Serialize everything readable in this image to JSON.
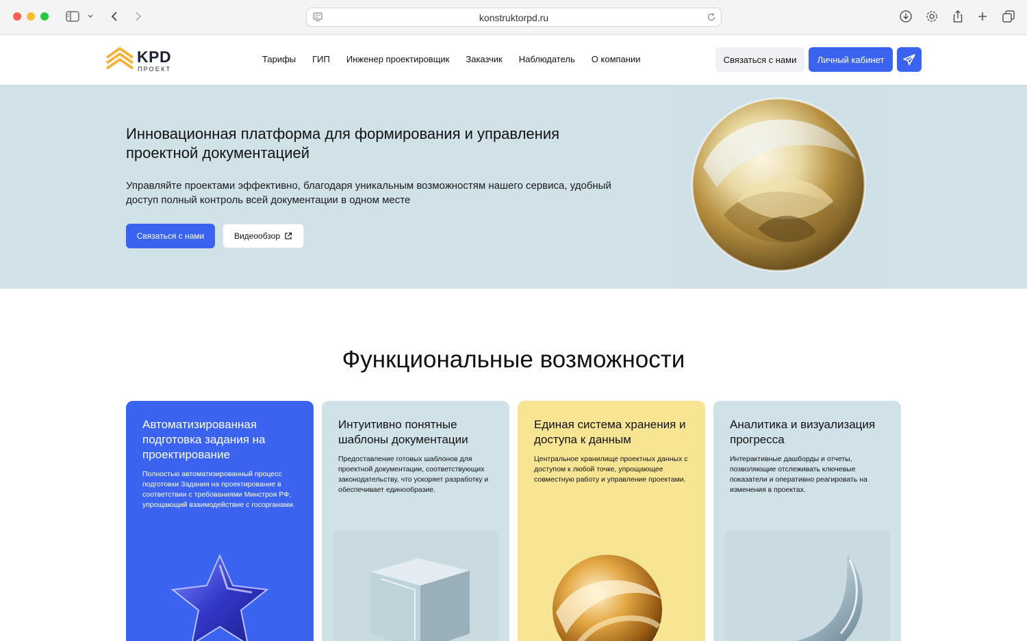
{
  "browser": {
    "url": "konstruktorpd.ru"
  },
  "header": {
    "logo_main": "KPD",
    "logo_sub": "ПРОЕКТ",
    "nav": [
      "Тарифы",
      "ГИП",
      "Инженер проектировщик",
      "Заказчик",
      "Наблюдатель",
      "О компании"
    ],
    "contact_label": "Связаться с нами",
    "cabinet_label": "Личный кабинет"
  },
  "hero": {
    "title": "Инновационная платформа для формирования и управления проектной документацией",
    "text": "Управляйте проектами эффективно, благодаря уникальным возможностям нашего сервиса, удобный доступ полный контроль всей документации в одном месте",
    "contact_label": "Связаться с нами",
    "video_label": "Видеообзор"
  },
  "features": {
    "title": "Функциональные возможности",
    "cards": [
      {
        "title": "Автоматизированная подготовка задания на проектирование",
        "text": "Полностью автоматизированный процесс подготовки Задания на проектирование в соответствии с требованиями Минстроя РФ, упрощающий взаимодействие с госорганами."
      },
      {
        "title": "Интуитивно понятные шаблоны документации",
        "text": "Предоставление готовых шаблонов для проектной документации, соответствующих законодательству, что ускоряет разработку и обеспечивает единообразие."
      },
      {
        "title": "Единая система хранения и доступа к данным",
        "text": "Центральное хранилище проектных данных с доступом к любой точке, упрощающее совместную работу и управление проектами."
      },
      {
        "title": "Аналитика и визуализация прогресса",
        "text": "Интерактивные дашборды и отчеты, позволяющие отслеживать ключевые показатели и оперативно реагировать на изменения в проектах."
      }
    ]
  },
  "colors": {
    "accent": "#3a63f0",
    "hero_bg": "#d0e1e8",
    "card_yellow": "#f8e594"
  }
}
